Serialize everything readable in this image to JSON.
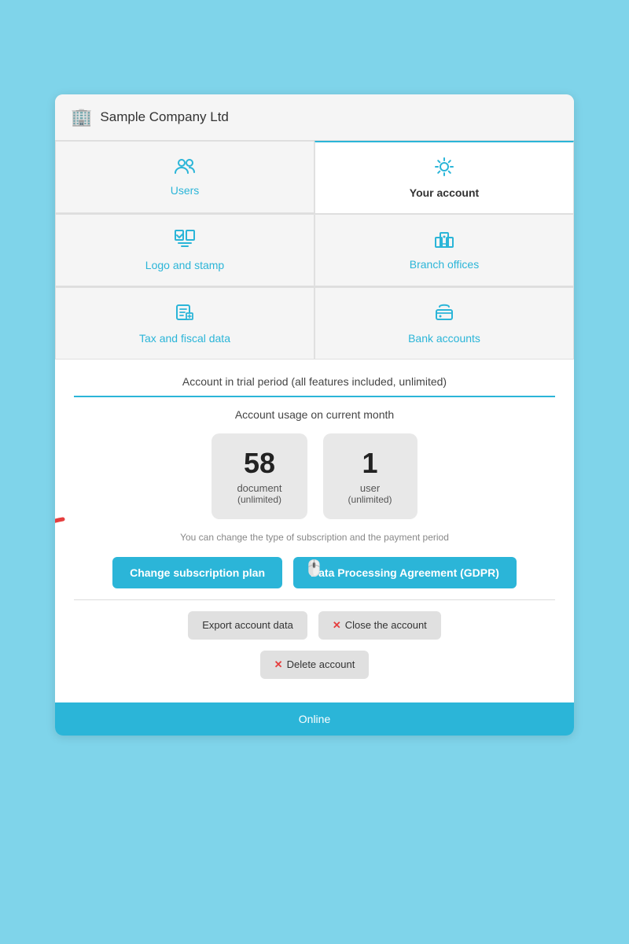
{
  "header": {
    "company_icon": "🏢",
    "company_name": "Sample Company Ltd"
  },
  "tabs": [
    {
      "id": "users",
      "label": "Users",
      "icon": "👥",
      "active": false
    },
    {
      "id": "your-account",
      "label": "Your account",
      "icon": "⚙️",
      "active": true
    },
    {
      "id": "logo-stamp",
      "label": "Logo and stamp",
      "icon": "🖼️",
      "active": false
    },
    {
      "id": "branch-offices",
      "label": "Branch offices",
      "icon": "🏢",
      "active": false
    },
    {
      "id": "tax-fiscal",
      "label": "Tax and fiscal data",
      "icon": "📋",
      "active": false
    },
    {
      "id": "bank-accounts",
      "label": "Bank accounts",
      "icon": "🏦",
      "active": false
    }
  ],
  "content": {
    "trial_text": "Account in trial period (all features included, unlimited)",
    "usage_label": "Account usage on current month",
    "stats": [
      {
        "number": "58",
        "type": "document",
        "limit": "(unlimited)"
      },
      {
        "number": "1",
        "type": "user",
        "limit": "(unlimited)"
      }
    ],
    "hint_text": "You can change the type of subscription and the payment period",
    "buttons": {
      "change_plan": "Change subscription plan",
      "gdpr": "Data Processing Agreement (GDPR)",
      "export": "Export account data",
      "close_account": "Close the account",
      "delete_account": "Delete account"
    },
    "bottom_bar_label": "Online"
  },
  "colors": {
    "primary": "#2bb5d8",
    "bg": "#7fd4ea",
    "card_bg": "#f5f5f5",
    "white": "#ffffff",
    "danger_x": "#e53e3e"
  }
}
